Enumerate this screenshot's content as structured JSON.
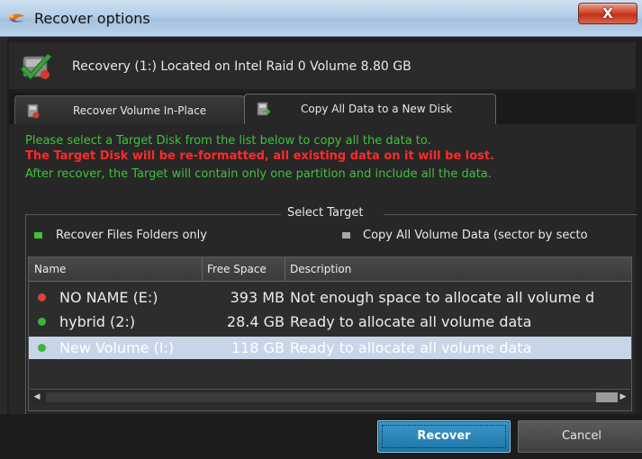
{
  "window": {
    "title": "Recover options",
    "close_label": "X"
  },
  "info": {
    "text": "Recovery (1:) Located on Intel Raid 0 Volume 8.80 GB"
  },
  "tabs": [
    {
      "label": "Recover Volume In-Place",
      "active": false
    },
    {
      "label": "Copy All Data to a New Disk",
      "active": true
    }
  ],
  "messages": {
    "line1": "Please select a Target Disk from the list below to copy all the data to.",
    "line2": "The Target Disk will be re-formatted, all existing data on it will be lost.",
    "line3": "After recover, the Target will contain only one partition and include all the data."
  },
  "select_target": {
    "title": "Select Target",
    "option_files": "Recover Files  Folders only",
    "option_sector": "Copy All Volume Data (sector by secto"
  },
  "list": {
    "columns": [
      "Name",
      "Free Space",
      "Description"
    ],
    "rows": [
      {
        "name": "NO NAME (E:)",
        "free": "393 MB",
        "desc": "Not enough space to allocate all volume d",
        "status": "red",
        "selected": false
      },
      {
        "name": "hybrid (2:)",
        "free": "28.4 GB",
        "desc": "Ready to allocate all volume data",
        "status": "green",
        "selected": false
      },
      {
        "name": "New Volume (I:)",
        "free": "118 GB",
        "desc": "Ready to allocate all volume data",
        "status": "green",
        "selected": true
      }
    ]
  },
  "buttons": {
    "recover": "Recover",
    "cancel": "Cancel"
  },
  "colors": {
    "accent_green": "#40c23c",
    "warning_red": "#ff2a2a",
    "status_red": "#e0403a",
    "status_green": "#3fb33a",
    "selected_row": "#c7d5e8",
    "primary_button": "#2a86b8"
  }
}
